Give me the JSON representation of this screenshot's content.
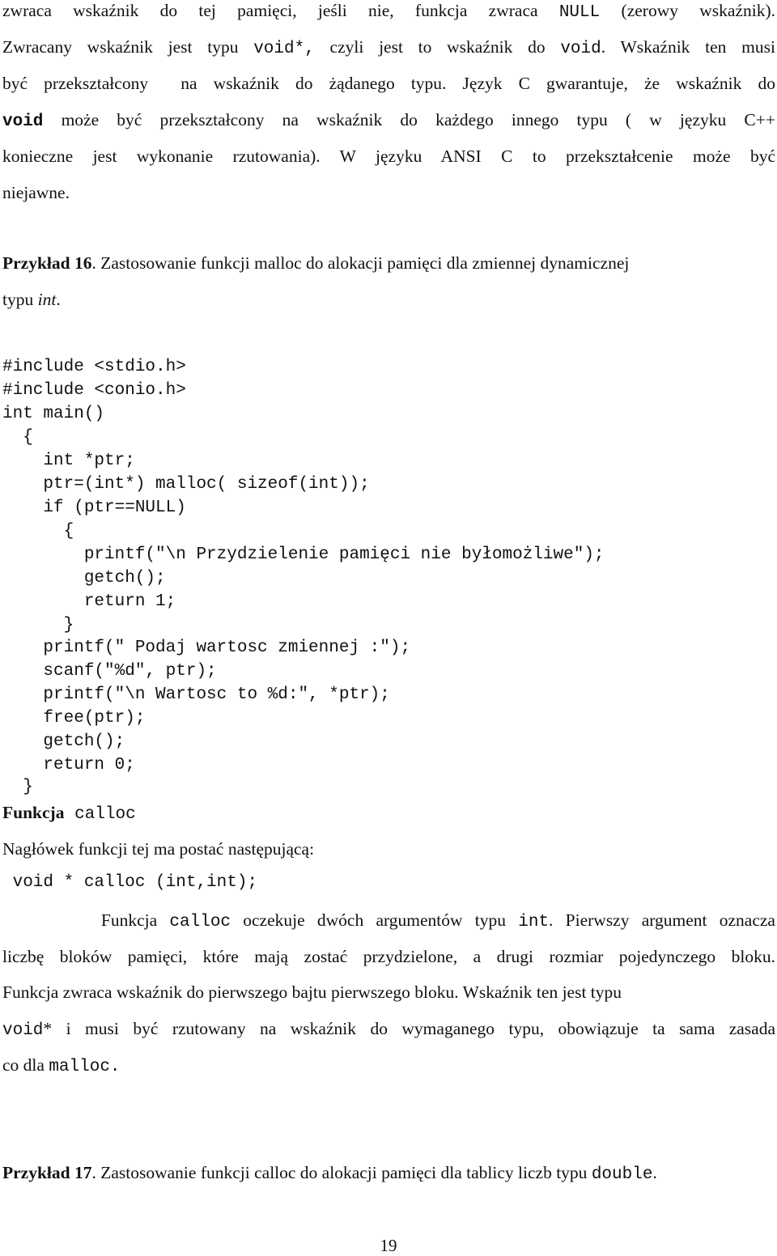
{
  "paragraph1": {
    "l1_a": "zwraca wskaźnik do tej pamięci, jeśli nie, funkcja zwraca ",
    "l1_code": "NULL",
    "l1_b": " (zerowy wskaźnik).",
    "l2_a": "Zwracany wskaźnik jest typu ",
    "l2_code1": "void*,",
    "l2_b": " czyli jest to wskaźnik do ",
    "l2_code2": "void",
    "l2_c": ". Wskaźnik ten musi",
    "l3": "być przekształcony  na wskaźnik do żądanego typu. Język C gwarantuje, że wskaźnik do",
    "l4_code": "void",
    "l4_b": " może być przekształcony na wskaźnik do każdego innego typu ( w języku C++",
    "l5": "konieczne jest wykonanie rzutowania). W języku ANSI C to przekształcenie może być",
    "l6": "niejawne."
  },
  "example16": {
    "label": "Przykład 16",
    "text_a": ". Zastosowanie funkcji malloc do alokacji pamięci dla zmiennej dynamicznej",
    "text_b": "typu ",
    "text_italic": "int",
    "text_end": "."
  },
  "code16": [
    "#include <stdio.h>",
    "#include <conio.h>",
    "int main()",
    "  {",
    "    int *ptr;",
    "    ptr=(int*) malloc( sizeof(int));",
    "    if (ptr==NULL)",
    "      {",
    "        printf(\"\\n Przydzielenie pamięci nie byłomożliwe\");",
    "        getch();",
    "        return 1;",
    "      }",
    "    printf(″ Podaj wartosc zmiennej :″);",
    "    scanf(\"%d\", ptr);",
    "    printf(″\\n Wartosc to %d:″, *ptr);",
    "    free(ptr);",
    "    getch();",
    "    return 0;",
    "  }"
  ],
  "calloc_section": {
    "heading_bold": "Funkcja",
    "heading_code": " calloc",
    "intro": "Nagłówek funkcji tej ma postać następującą:",
    "signature": " void * calloc (int,int);",
    "p_l1_a": "        Funkcja ",
    "p_l1_code1": "calloc",
    "p_l1_b": " oczekuje dwóch argumentów typu ",
    "p_l1_code2": "int",
    "p_l1_c": ". Pierwszy argument oznacza",
    "p_l2": "liczbę bloków pamięci, które mają zostać przydzielone, a drugi rozmiar pojedynczego bloku.",
    "p_l3": "Funkcja zwraca wskaźnik do pierwszego bajtu pierwszego bloku. Wskaźnik ten jest typu",
    "p_l4_code": "void",
    "p_l4_b": "* i musi być rzutowany na wskaźnik do wymaganego typu, obowiązuje ta sama zasada",
    "p_l5_a": "co dla ",
    "p_l5_code": "malloc."
  },
  "example17": {
    "label": "Przykład 17",
    "text_a": ". Zastosowanie funkcji calloc do alokacji pamięci dla tablicy liczb typu ",
    "text_code": "double",
    "text_end": "."
  },
  "page_number": "19"
}
